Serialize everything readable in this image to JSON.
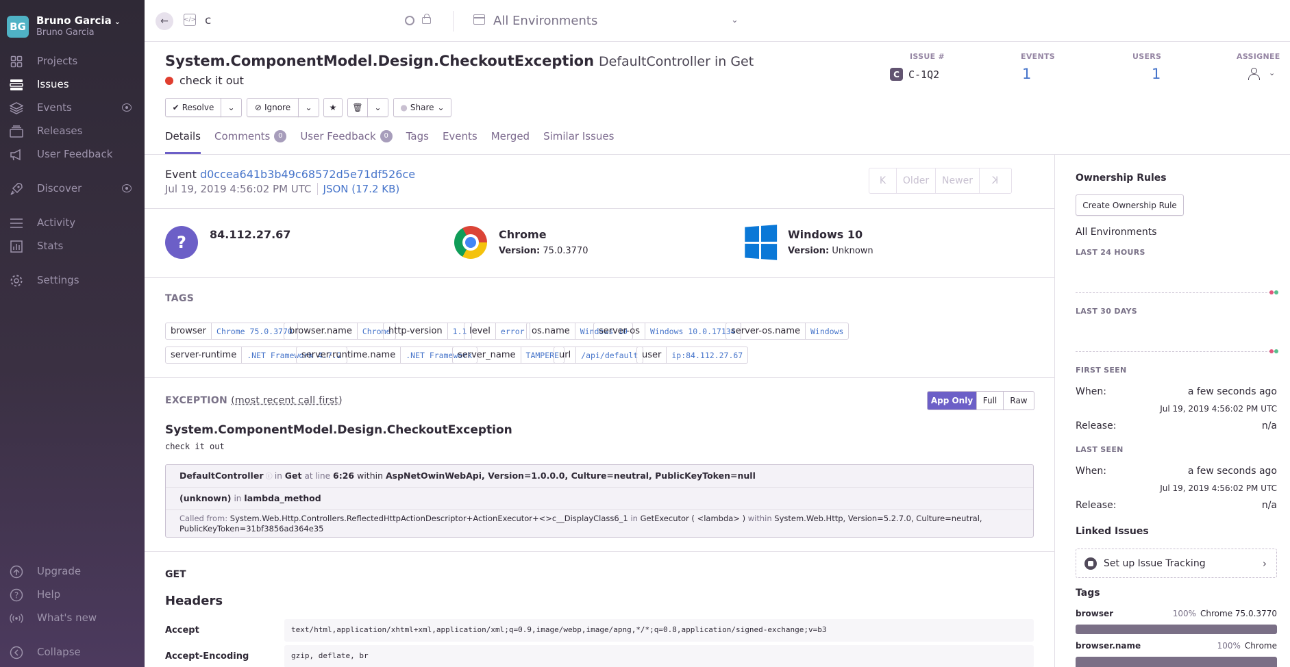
{
  "org": {
    "avatar": "BG",
    "name": "Bruno Garcia",
    "user": "Bruno Garcia"
  },
  "nav": {
    "projects": "Projects",
    "issues": "Issues",
    "events": "Events",
    "releases": "Releases",
    "user_feedback": "User Feedback",
    "discover": "Discover",
    "activity": "Activity",
    "stats": "Stats",
    "settings": "Settings",
    "upgrade": "Upgrade",
    "help": "Help",
    "whats_new": "What's new",
    "collapse": "Collapse"
  },
  "topbar": {
    "project": "c",
    "environment": "All Environments"
  },
  "issue": {
    "title": "System.ComponentModel.Design.CheckoutException",
    "culprit": "DefaultController in Get",
    "message": "check it out",
    "stats": {
      "issue_label": "ISSUE #",
      "short_id": "C-1Q2",
      "project_initial": "C",
      "events_label": "EVENTS",
      "events": "1",
      "users_label": "USERS",
      "users": "1",
      "assignee_label": "ASSIGNEE"
    }
  },
  "actions": {
    "resolve": "Resolve",
    "ignore": "Ignore",
    "share": "Share"
  },
  "tabs": {
    "details": "Details",
    "comments": "Comments",
    "comments_count": "0",
    "user_feedback": "User Feedback",
    "user_feedback_count": "0",
    "tags": "Tags",
    "events": "Events",
    "merged": "Merged",
    "similar": "Similar Issues"
  },
  "event": {
    "label": "Event",
    "id": "d0ccea641b3b49c68572d5e71df526ce",
    "date": "Jul 19, 2019 4:56:02 PM UTC",
    "json": "JSON (17.2 KB)",
    "pager": {
      "oldest": "K",
      "older": "Older",
      "newer": "Newer",
      "newest": "K"
    }
  },
  "contexts": {
    "user": {
      "name": "84.112.27.67",
      "icon_glyph": "?"
    },
    "browser": {
      "name": "Chrome",
      "version_label": "Version:",
      "version": "75.0.3770"
    },
    "os": {
      "name": "Windows 10",
      "version_label": "Version:",
      "version": "Unknown"
    }
  },
  "tags_section": {
    "heading": "TAGS",
    "items": [
      {
        "key": "browser",
        "value": "Chrome 75.0.3770"
      },
      {
        "key": "browser.name",
        "value": "Chrome"
      },
      {
        "key": "http-version",
        "value": "1.1"
      },
      {
        "key": "level",
        "value": "error"
      },
      {
        "key": "os.name",
        "value": "Windows 10"
      },
      {
        "key": "server-os",
        "value": "Windows 10.0.17134"
      },
      {
        "key": "server-os.name",
        "value": "Windows"
      },
      {
        "key": "server-runtime",
        "value": ".NET Framework 4.7.2"
      },
      {
        "key": "server-runtime.name",
        "value": ".NET Framework"
      },
      {
        "key": "server_name",
        "value": "TAMPERE"
      },
      {
        "key": "url",
        "value": "/api/default"
      },
      {
        "key": "user",
        "value": "ip:84.112.27.67"
      }
    ]
  },
  "exception": {
    "heading": "EXCEPTION",
    "order_note": "(most recent call first)",
    "toggle": {
      "app_only": "App Only",
      "full": "Full",
      "raw": "Raw"
    },
    "type": "System.ComponentModel.Design.CheckoutException",
    "value": "check it out",
    "frame1": {
      "function": "DefaultController",
      "in": "in",
      "method": "Get",
      "at_line": "at line",
      "line": "6:26",
      "within": "within",
      "package": "AspNetOwinWebApi, Version=1.0.0.0, Culture=neutral, PublicKeyToken=null"
    },
    "frame2": {
      "function": "(unknown)",
      "in": "in",
      "method": "lambda_method"
    },
    "called_from": {
      "label": "Called from:",
      "function": "System.Web.Http.Controllers.ReflectedHttpActionDescriptor+ActionExecutor+<>c__DisplayClass6_1",
      "in": "in",
      "method": "GetExecutor ( <lambda> )",
      "within": "within",
      "package": "System.Web.Http, Version=5.2.7.0, Culture=neutral,",
      "token": "PublicKeyToken=31bf3856ad364e35"
    }
  },
  "request": {
    "method": "GET",
    "headers_heading": "Headers",
    "headers": [
      {
        "key": "Accept",
        "value": "text/html,application/xhtml+xml,application/xml;q=0.9,image/webp,image/apng,*/*;q=0.8,application/signed-exchange;v=b3"
      },
      {
        "key": "Accept-Encoding",
        "value": "gzip, deflate, br"
      }
    ]
  },
  "sidebar_right": {
    "ownership_heading": "Ownership Rules",
    "create_rule": "Create Ownership Rule",
    "environments": "All Environments",
    "last_24h": "LAST 24 HOURS",
    "last_30d": "LAST 30 DAYS",
    "first_seen": "FIRST SEEN",
    "last_seen": "LAST SEEN",
    "when_label": "When:",
    "release_label": "Release:",
    "first_when": "a few seconds ago",
    "first_date": "Jul 19, 2019 4:56:02 PM UTC",
    "first_release": "n/a",
    "last_when": "a few seconds ago",
    "last_date": "Jul 19, 2019 4:56:02 PM UTC",
    "last_release": "n/a",
    "linked_heading": "Linked Issues",
    "setup_tracking": "Set up Issue Tracking",
    "tags_heading": "Tags",
    "tag1": {
      "key": "browser",
      "pct": "100%",
      "value": "Chrome 75.0.3770",
      "fraction": 1.0
    },
    "tag2": {
      "key": "browser.name",
      "pct": "100%",
      "value": "Chrome",
      "fraction": 1.0
    }
  },
  "colors": {
    "accent": "#6c5fc7",
    "link": "#4674ca",
    "error": "#e03e2f",
    "sidebar_bg": "#2f2936"
  }
}
